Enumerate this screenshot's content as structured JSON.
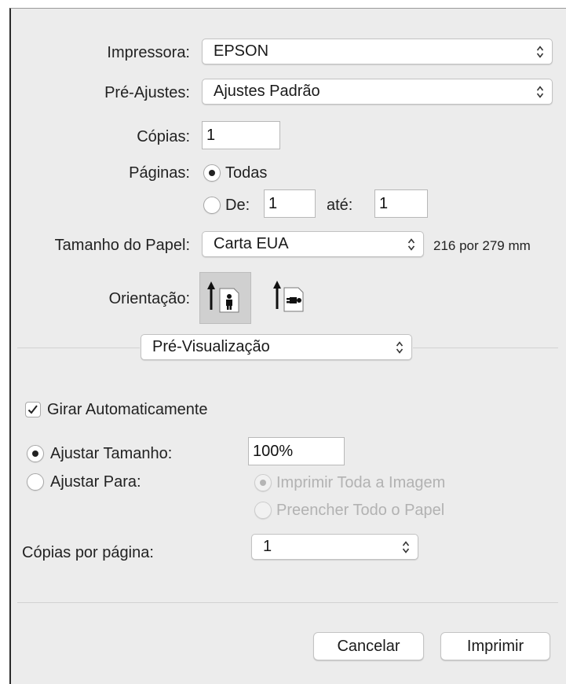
{
  "printer": {
    "label": "Impressora:",
    "value": "EPSON"
  },
  "presets": {
    "label": "Pré-Ajustes:",
    "value": "Ajustes Padrão"
  },
  "copies": {
    "label": "Cópias:",
    "value": "1"
  },
  "pages": {
    "label": "Páginas:",
    "all_label": "Todas",
    "from_label": "De:",
    "from_value": "1",
    "to_label": "até:",
    "to_value": "1",
    "selected": "all"
  },
  "paper_size": {
    "label": "Tamanho do Papel:",
    "value": "Carta EUA",
    "dimensions": "216 por 279 mm"
  },
  "orientation": {
    "label": "Orientação:",
    "selected": "portrait"
  },
  "section_popup": {
    "value": "Pré-Visualização"
  },
  "auto_rotate": {
    "label": "Girar Automaticamente",
    "checked": true
  },
  "scale": {
    "adjust_size_label": "Ajustar Tamanho:",
    "adjust_size_value": "100%",
    "fit_label": "Ajustar Para:",
    "fit_option_print_all": "Imprimir Toda a Imagem",
    "fit_option_fill": "Preencher Todo o Papel",
    "selected": "adjust_size"
  },
  "copies_per_page": {
    "label": "Cópias por página:",
    "value": "1"
  },
  "buttons": {
    "cancel": "Cancelar",
    "print": "Imprimir"
  },
  "icons": {
    "popup_arrows": "up-down-chevrons-icon",
    "portrait": "portrait-orientation-icon",
    "landscape": "landscape-orientation-icon",
    "checkmark": "checkmark-icon"
  },
  "colors": {
    "dialog_bg": "#ececec",
    "disabled_text": "#b2b2b2",
    "selected_orientation_bg": "#d0d0d0"
  }
}
